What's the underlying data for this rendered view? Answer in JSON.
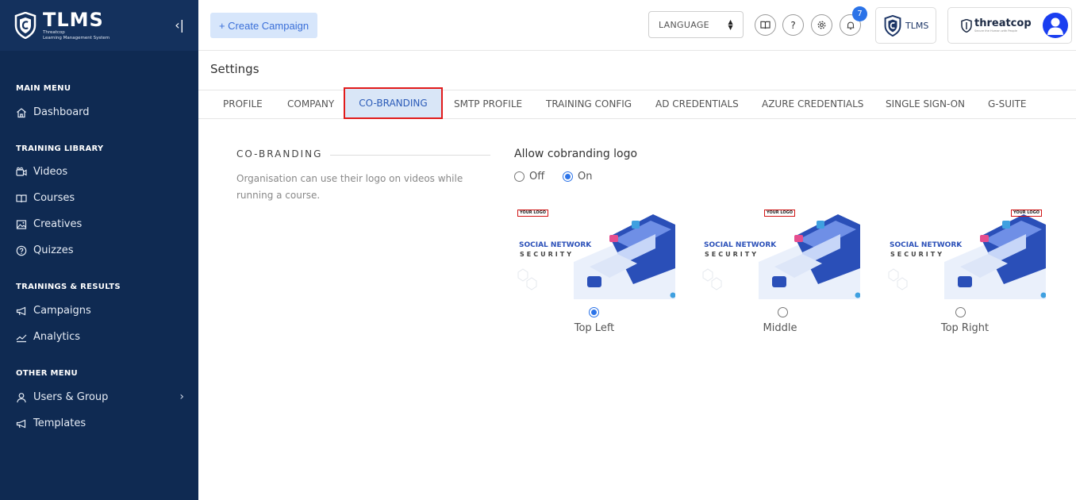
{
  "sidebar": {
    "brand_title": "TLMS",
    "brand_subtitle_1": "Threatcop",
    "brand_subtitle_2": "Learning Management System",
    "collapse_label": "‹|",
    "sections": [
      {
        "title": "MAIN MENU",
        "items": [
          {
            "label": "Dashboard",
            "icon": "home-icon"
          }
        ]
      },
      {
        "title": "TRAINING LIBRARY",
        "items": [
          {
            "label": "Videos",
            "icon": "video-icon"
          },
          {
            "label": "Courses",
            "icon": "book-icon"
          },
          {
            "label": "Creatives",
            "icon": "image-icon"
          },
          {
            "label": "Quizzes",
            "icon": "help-circle-icon"
          }
        ]
      },
      {
        "title": "TRAININGS & RESULTS",
        "items": [
          {
            "label": "Campaigns",
            "icon": "megaphone-icon"
          },
          {
            "label": "Analytics",
            "icon": "trend-icon"
          }
        ]
      },
      {
        "title": "OTHER MENU",
        "items": [
          {
            "label": "Users & Group",
            "icon": "user-icon"
          },
          {
            "label": "Templates",
            "icon": "megaphone-icon"
          }
        ]
      }
    ],
    "users_chevron": "›"
  },
  "topbar": {
    "create_campaign": "+ Create Campaign",
    "language": "LANGUAGE",
    "help": "?",
    "notification_count": "7",
    "tlms_label": "TLMS",
    "threatcop_label": "threatcop",
    "threatcop_tagline": "Secure the Human with People"
  },
  "page": {
    "title": "Settings",
    "tabs": [
      "PROFILE",
      "COMPANY",
      "CO-BRANDING",
      "SMTP PROFILE",
      "TRAINING CONFIG",
      "AD CREDENTIALS",
      "AZURE CREDENTIALS",
      "SINGLE SIGN-ON",
      "G-SUITE"
    ],
    "active_tab": "CO-BRANDING"
  },
  "cobranding": {
    "section_title": "CO-BRANDING",
    "description": "Organisation can use their logo on videos while running a course.",
    "allow_label": "Allow cobranding logo",
    "off_label": "Off",
    "on_label": "On",
    "selected": "On",
    "thumb_logo_text": "YOUR LOGO",
    "thumb_line1": "SOCIAL NETWORK",
    "thumb_line2": "SECURITY",
    "positions": [
      {
        "label": "Top Left",
        "selected": true
      },
      {
        "label": "Middle",
        "selected": false
      },
      {
        "label": "Top Right",
        "selected": false
      }
    ]
  },
  "colors": {
    "sidebar_bg": "#0f2a52",
    "accent": "#2b73e8",
    "highlight_border": "#e11b1b",
    "active_tab_bg": "#d9e6f7"
  }
}
